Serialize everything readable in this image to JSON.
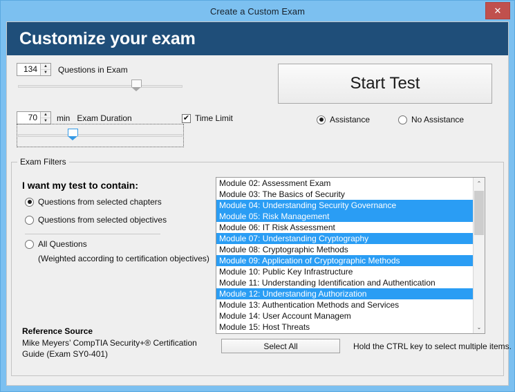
{
  "window": {
    "title": "Create a Custom Exam",
    "close_label": "✕",
    "banner_title": "Customize your exam",
    "title_bar_color": "#7cc0f0",
    "banner_color": "#1f4e79",
    "close_color": "#c0504d",
    "selection_color": "#2a9df4"
  },
  "questions": {
    "value": "134",
    "label": "Questions in Exam",
    "slider_percent": 72,
    "spin_up": "▲",
    "spin_down": "▼"
  },
  "duration": {
    "value": "70",
    "unit": "min",
    "label": "Exam Duration",
    "slider_percent": 33,
    "spin_up": "▲",
    "spin_down": "▼"
  },
  "time_limit": {
    "label": "Time Limit",
    "checked": true,
    "check_glyph": "✔"
  },
  "start": {
    "button_label": "Start Test",
    "assistance_label": "Assistance",
    "no_assistance_label": "No Assistance",
    "assistance_selected": true
  },
  "filters": {
    "legend": "Exam Filters",
    "heading": "I want my test to contain:",
    "option_chapters": "Questions from selected chapters",
    "option_objectives": "Questions from selected objectives",
    "option_all": "All Questions",
    "all_note": "(Weighted according to certification objectives)"
  },
  "modules": {
    "items": [
      {
        "label": "Module 02: Assessment Exam",
        "selected": false
      },
      {
        "label": "Module 03: The Basics of Security",
        "selected": false
      },
      {
        "label": "Module 04: Understanding Security Governance",
        "selected": true
      },
      {
        "label": "Module 05: Risk Management",
        "selected": true
      },
      {
        "label": "Module 06: IT Risk Assessment",
        "selected": false
      },
      {
        "label": "Module 07: Understanding Cryptography",
        "selected": true
      },
      {
        "label": "Module 08: Cryptographic Methods",
        "selected": false
      },
      {
        "label": "Module 09: Application of Cryptographic Methods",
        "selected": true
      },
      {
        "label": "Module 10: Public Key Infrastructure",
        "selected": false
      },
      {
        "label": "Module 11: Understanding Identification and Authentication",
        "selected": false
      },
      {
        "label": "Module 12: Understanding Authorization",
        "selected": true
      },
      {
        "label": "Module 13: Authentication Methods and Services",
        "selected": false
      },
      {
        "label": "Module 14: User Account Managem",
        "selected": false
      },
      {
        "label": "Module 15: Host Threats",
        "selected": false
      }
    ],
    "scroll_up_glyph": "⌃",
    "scroll_down_glyph": "⌄"
  },
  "bottom": {
    "select_all_label": "Select All",
    "ctrl_hint": "Hold the CTRL key to select multiple items.",
    "reference_title": "Reference Source",
    "reference_line1": "Mike Meyers’ CompTIA Security+® Certification",
    "reference_line2": "Guide (Exam SY0-401)"
  }
}
